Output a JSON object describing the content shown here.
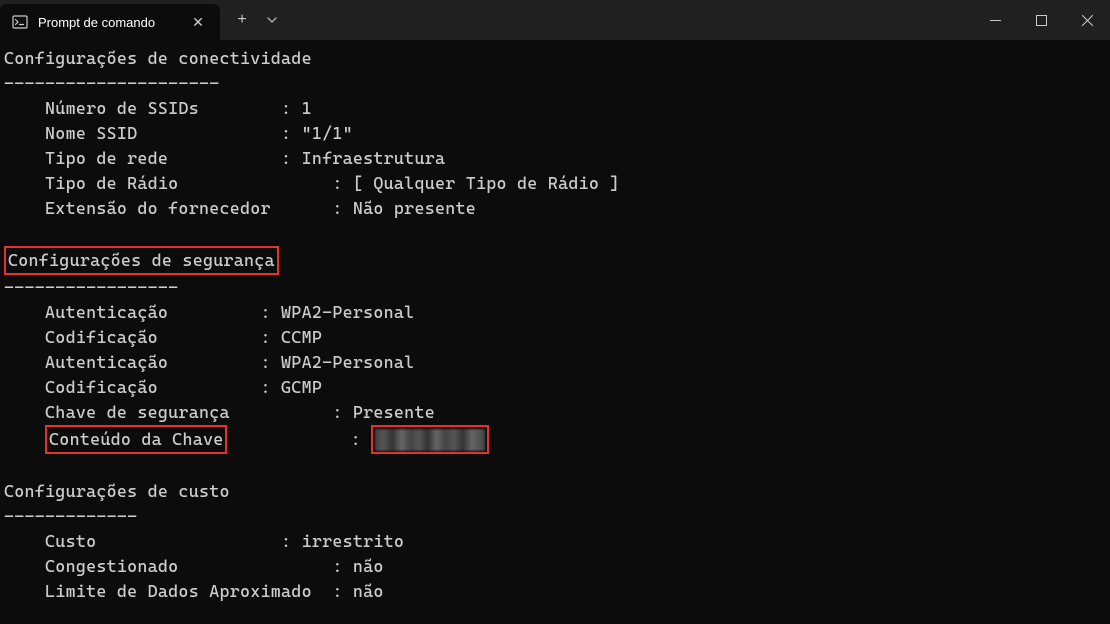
{
  "titlebar": {
    "tab_title": "Prompt de comando"
  },
  "terminal": {
    "connectivity_header": "Configurações de conectividade",
    "connectivity_divider": "---------------------",
    "ssid_count_label": "    Número de SSIDs        : ",
    "ssid_count_value": "1",
    "ssid_name_label": "    Nome SSID              : ",
    "ssid_name_value": "\"1/1\"",
    "network_type_label": "    Tipo de rede           : ",
    "network_type_value": "Infraestrutura",
    "radio_type_label": "    Tipo de Rádio               : ",
    "radio_type_value": "[ Qualquer Tipo de Rádio ]",
    "vendor_ext_label": "    Extensão do fornecedor      : ",
    "vendor_ext_value": "Não presente",
    "security_header": "Configurações de segurança",
    "security_divider": "-----------------",
    "auth1_label": "    Autenticação         : ",
    "auth1_value": "WPA2-Personal",
    "cipher1_label": "    Codificação          : ",
    "cipher1_value": "CCMP",
    "auth2_label": "    Autenticação         : ",
    "auth2_value": "WPA2-Personal",
    "cipher2_label": "    Codificação          : ",
    "cipher2_value": "GCMP",
    "security_key_label": "    Chave de segurança          : ",
    "security_key_value": "Presente",
    "key_content_label": "Conteúdo da Chave",
    "key_content_pad": "            : ",
    "cost_header": "Configurações de custo",
    "cost_divider": "-------------",
    "cost_label": "    Custo                  : ",
    "cost_value": "irrestrito",
    "congested_label": "    Congestionado               : ",
    "congested_value": "não",
    "data_limit_label": "    Limite de Dados Aproximado  : ",
    "data_limit_value": "não"
  }
}
